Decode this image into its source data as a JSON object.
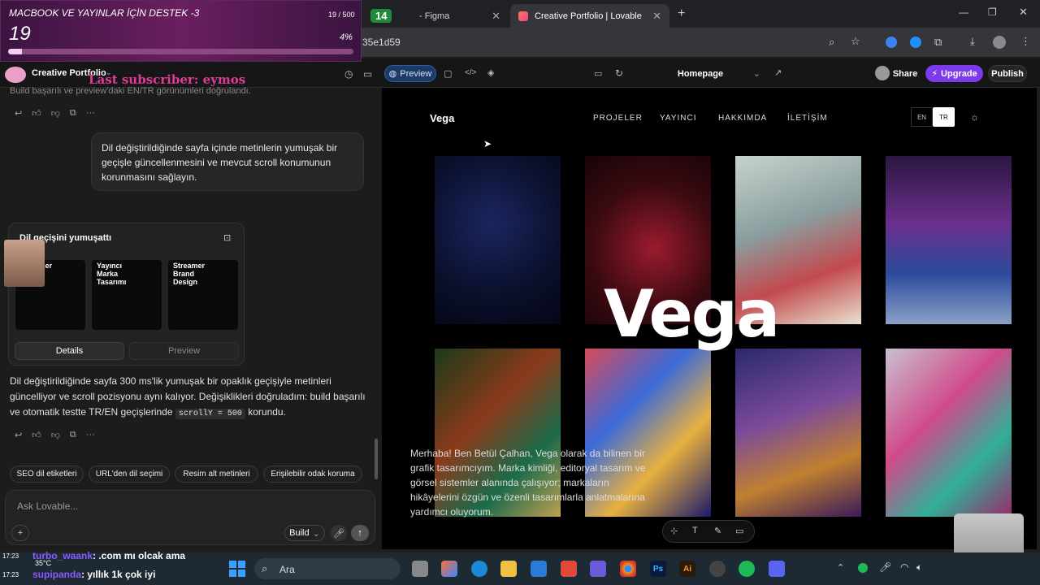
{
  "overlay": {
    "title": "MACBOOK VE YAYINLAR İÇİN DESTEK -3",
    "count": "19 / 500",
    "big": "19",
    "pct": "4%",
    "progress": 0.04,
    "subscriber": "Last subscriber: eymos"
  },
  "tabs": [
    {
      "label": "14"
    },
    {
      "label": "- Figma"
    },
    {
      "label": "Creative Portfolio | Lovable"
    }
  ],
  "address": {
    "url": "35e1d59"
  },
  "lovable": {
    "project": "Creative Portfolio",
    "preview_btn": "Preview",
    "page_select": "Homepage",
    "share": "Share",
    "upgrade": "Upgrade",
    "publish": "Publish"
  },
  "chat": {
    "top_text": "Build başarılı ve preview'daki EN/TR görünümleri doğrulandı.",
    "user_msg": "Dil değiştirildiğinde sayfa içinde metinlerin yumuşak bir geçişle güncellenmesini ve mevcut scroll konumunun korunmasını sağlayın.",
    "card_title": "Dil geçişini yumuşattı",
    "thumbs": [
      "Streamer\nDesign\nn",
      "Yayıncı\nMarka\nTasarımı",
      "Streamer\nBrand\nDesign"
    ],
    "details": "Details",
    "preview": "Preview",
    "reply_1": "Dil değiştirildiğinde sayfa 300 ms'lik yumuşak bir opaklık geçişiyle metinleri güncelliyor ve scroll pozisyonu aynı kalıyor. Değişiklikleri doğruladım: build başarılı ve otomatik testte TR/EN geçişlerinde",
    "code": "scrollY = 500",
    "reply_2": "korundu.",
    "chips": [
      "SEO dil etiketleri",
      "URL'den dil seçimi",
      "Resim alt metinleri",
      "Erişilebilir odak koruma"
    ],
    "input_placeholder": "Ask Lovable...",
    "build": "Build"
  },
  "site": {
    "logo": "Vega",
    "nav": [
      "PROJELER",
      "YAYINCI",
      "HAKKIMDA",
      "İLETİŞİM"
    ],
    "lang": [
      "EN",
      "TR"
    ],
    "hero": "Vega",
    "bio": "Merhaba! Ben Betül Çalhan, Vega olarak da bilinen bir grafik tasarımcıyım. Marka kimliği, editoryal tasarım ve görsel sistemler alanında çalışıyor; markaların hikâyelerini özgün ve özenli tasarımlarla anlatmalarına yardımcı oluyorum."
  },
  "stream_chat": [
    {
      "user": "turbo_waank",
      "msg": ": .com mı olcak ama"
    },
    {
      "user": "supipanda",
      "msg": ": yıllık 1k çok iyi"
    }
  ],
  "taskbar": {
    "search": "Ara",
    "time": "17:23",
    "temp": "35°C"
  }
}
